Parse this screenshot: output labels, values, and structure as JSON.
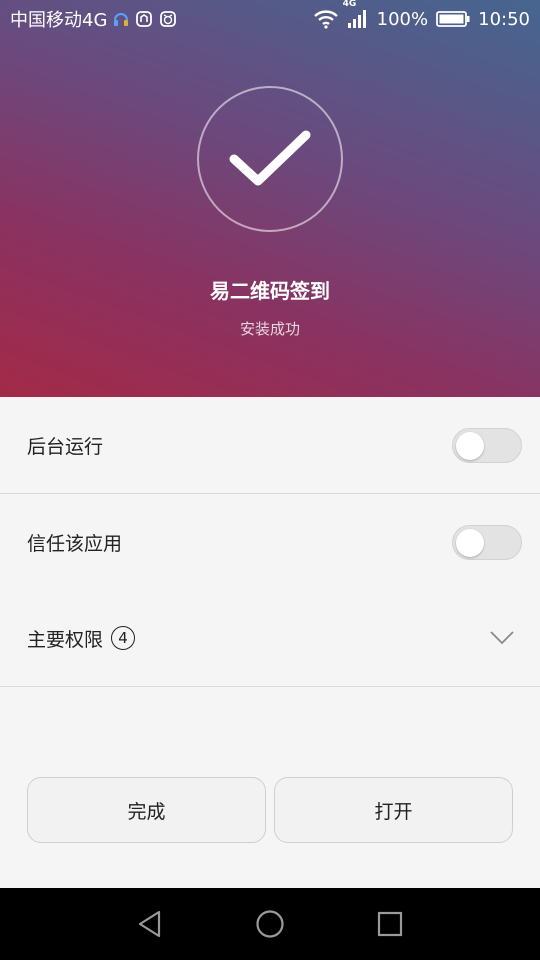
{
  "status_bar": {
    "carrier": "中国移动4G",
    "network_badge": "4G",
    "battery": "100%",
    "time": "10:50"
  },
  "hero": {
    "icon": "checkmark-icon",
    "app_name": "易二维码签到",
    "status": "安装成功"
  },
  "settings": [
    {
      "label": "后台运行",
      "toggle_on": false
    },
    {
      "label": "信任该应用",
      "toggle_on": false
    }
  ],
  "permissions": {
    "label": "主要权限",
    "count": "4"
  },
  "buttons": {
    "done": "完成",
    "open": "打开"
  },
  "colors": {
    "background": "#f5f5f5",
    "navbar": "#000000"
  }
}
